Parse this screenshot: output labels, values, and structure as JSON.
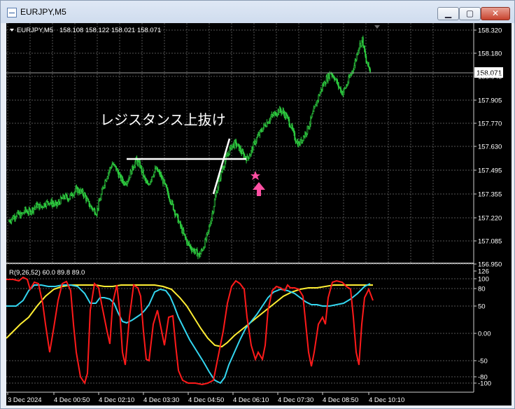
{
  "window": {
    "title": "EURJPY,M5",
    "minimize_glyph": "▁",
    "maximize_glyph": "▢",
    "close_glyph": "✕"
  },
  "main_chart": {
    "header_symbol": "EURJPY,M5",
    "header_ohlc": "158.108 158.122 158.021 158.071",
    "current_price": "158.071",
    "annotation": "レジスタンス上抜け",
    "price_labels": [
      "158.320",
      "158.180",
      "158.045",
      "157.905",
      "157.770",
      "157.630",
      "157.495",
      "157.355",
      "157.220",
      "157.085",
      "156.950"
    ]
  },
  "indicator": {
    "header": "R(9,26,52) 60.0 89.8 89.0",
    "level_labels": [
      "126",
      "100",
      "80",
      "50",
      "0.00",
      "-50",
      "-80",
      "-100"
    ]
  },
  "time_labels": [
    "3 Dec 2024",
    "4 Dec 00:50",
    "4 Dec 02:10",
    "4 Dec 03:30",
    "4 Dec 04:50",
    "4 Dec 06:10",
    "4 Dec 07:30",
    "4 Dec 08:50",
    "4 Dec 10:10"
  ],
  "colors": {
    "candles": "#2ecc40",
    "indicator_red": "#ff1a1a",
    "indicator_cyan": "#33d6f0",
    "indicator_yellow": "#ffee33",
    "signal_star": "#ff4fa3"
  },
  "chart_data": {
    "type": "candlestick",
    "symbol": "EURJPY",
    "timeframe": "M5",
    "ylim": [
      156.95,
      158.32
    ],
    "close_series": [
      157.2,
      157.22,
      157.24,
      157.23,
      157.26,
      157.25,
      157.27,
      157.29,
      157.28,
      157.3,
      157.31,
      157.3,
      157.29,
      157.32,
      157.34,
      157.33,
      157.36,
      157.38,
      157.37,
      157.35,
      157.3,
      157.27,
      157.25,
      157.33,
      157.42,
      157.48,
      157.53,
      157.5,
      157.45,
      157.42,
      157.44,
      157.5,
      157.55,
      157.52,
      157.45,
      157.4,
      157.46,
      157.5,
      157.47,
      157.42,
      157.36,
      157.3,
      157.24,
      157.18,
      157.12,
      157.07,
      157.04,
      157.02,
      157.0,
      157.05,
      157.12,
      157.22,
      157.34,
      157.44,
      157.52,
      157.58,
      157.63,
      157.65,
      157.62,
      157.58,
      157.56,
      157.6,
      157.66,
      157.7,
      157.74,
      157.77,
      157.8,
      157.82,
      157.84,
      157.83,
      157.8,
      157.75,
      157.68,
      157.64,
      157.68,
      157.72,
      157.78,
      157.85,
      157.92,
      157.98,
      158.02,
      158.06,
      158.03,
      157.98,
      157.94,
      157.98,
      158.04,
      158.1,
      158.2,
      158.25,
      158.12,
      158.07
    ]
  }
}
